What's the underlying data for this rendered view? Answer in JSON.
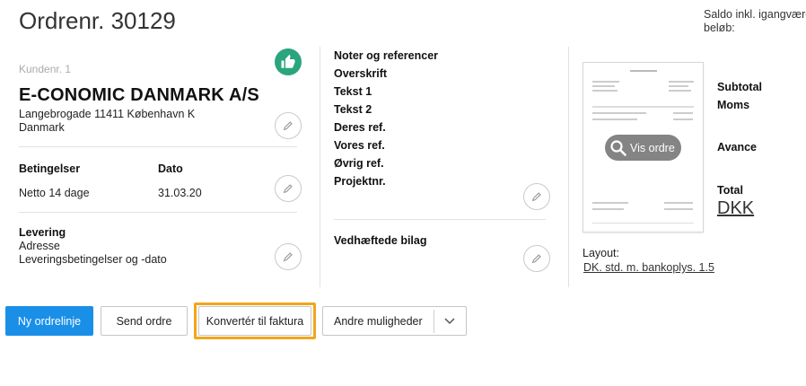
{
  "header": {
    "title": "Ordrenr. 30129",
    "saldo_line1": "Saldo inkl. igangvære",
    "saldo_line2": "beløb:"
  },
  "customer": {
    "number_label": "Kundenr. 1",
    "name": "E-CONOMIC DANMARK A/S",
    "address": "Langebrogade 11411 København K",
    "country": "Danmark"
  },
  "terms": {
    "conditions_label": "Betingelser",
    "conditions_value": "Netto 14 dage",
    "date_label": "Dato",
    "date_value": "31.03.20"
  },
  "delivery": {
    "label": "Levering",
    "address": "Adresse",
    "conditions": "Leveringsbetingelser og -dato"
  },
  "notes": {
    "header": "Noter og referencer",
    "items": [
      "Overskrift",
      "Tekst 1",
      "Tekst 2",
      "Deres ref.",
      "Vores ref.",
      "Øvrig ref.",
      "Projektnr."
    ],
    "attachments": "Vedhæftede bilag"
  },
  "preview": {
    "button_label": "Vis ordre",
    "layout_label": "Layout:",
    "layout_link": "DK. std. m. bankoplys. 1.5"
  },
  "totals": {
    "subtotal": "Subtotal",
    "moms": "Moms",
    "avance": "Avance",
    "total": "Total",
    "currency": "DKK"
  },
  "actions": {
    "new_line": "Ny ordrelinje",
    "send": "Send ordre",
    "convert": "Konvertér til faktura",
    "more": "Andre muligheder"
  },
  "colors": {
    "primary": "#1a8fe8",
    "highlight": "#f2a51a",
    "badge": "#2aa57e"
  }
}
